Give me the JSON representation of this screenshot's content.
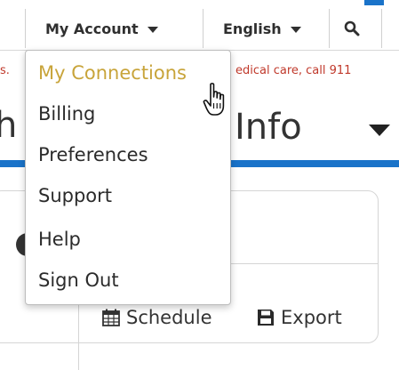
{
  "topbar": {
    "account_label": "My Account",
    "language_label": "English",
    "search_icon": "search-icon",
    "accent_color": "#1a73c9"
  },
  "notice": {
    "left_fragment": "s.",
    "right_fragment": "edical care, call 911",
    "color": "#c0392b"
  },
  "page": {
    "heading_left_fragment": "h",
    "heading_right_fragment": "Info"
  },
  "account_menu": {
    "items": [
      {
        "label": "My Connections",
        "active": true
      },
      {
        "label": "Billing"
      },
      {
        "label": "Preferences"
      },
      {
        "label": "Support"
      },
      {
        "label": "Help"
      },
      {
        "label": "Sign Out"
      }
    ],
    "active_color": "#c8a43a"
  },
  "toolbar": {
    "schedule_label": "Schedule",
    "schedule_icon": "calendar-icon",
    "export_label": "Export",
    "export_icon": "save-icon"
  }
}
